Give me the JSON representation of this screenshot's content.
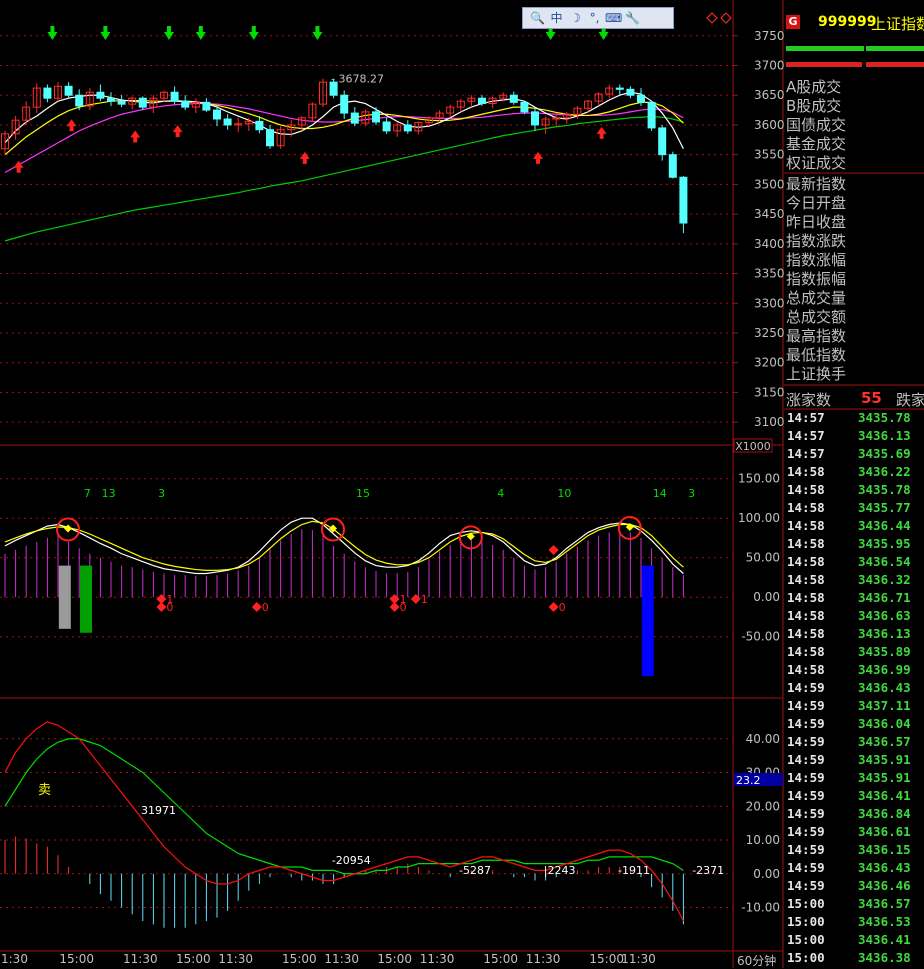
{
  "app": {
    "index_code": "999999",
    "index_name": "上证指数",
    "logo": "G",
    "period": "60分钟"
  },
  "toolbar": {
    "icons": [
      "magnify-icon",
      "chinese-input-icon",
      "moon-icon",
      "dots-icon",
      "keyboard-icon",
      "wrench-icon"
    ],
    "glyphs": [
      "🔍",
      "中",
      "☽",
      "°,",
      "⌨",
      "🔧"
    ]
  },
  "right_panel": {
    "labels": [
      "A股成交",
      "B股成交",
      "国债成交",
      "基金成交",
      "权证成交",
      "最新指数",
      "今日开盘",
      "昨日收盘",
      "指数涨跌",
      "指数涨幅",
      "指数振幅",
      "总成交量",
      "总成交额",
      "最高指数",
      "最低指数",
      "上证换手"
    ],
    "rise_label": "涨家数",
    "rise_count": "55",
    "fall_label": "跌家",
    "ticks": [
      [
        "14:57",
        "3435.78"
      ],
      [
        "14:57",
        "3436.13"
      ],
      [
        "14:57",
        "3435.69"
      ],
      [
        "14:58",
        "3436.22"
      ],
      [
        "14:58",
        "3435.78"
      ],
      [
        "14:58",
        "3435.77"
      ],
      [
        "14:58",
        "3436.44"
      ],
      [
        "14:58",
        "3435.95"
      ],
      [
        "14:58",
        "3436.54"
      ],
      [
        "14:58",
        "3436.32"
      ],
      [
        "14:58",
        "3436.71"
      ],
      [
        "14:58",
        "3436.63"
      ],
      [
        "14:58",
        "3436.13"
      ],
      [
        "14:58",
        "3435.89"
      ],
      [
        "14:58",
        "3436.99"
      ],
      [
        "14:59",
        "3436.43"
      ],
      [
        "14:59",
        "3437.11"
      ],
      [
        "14:59",
        "3436.04"
      ],
      [
        "14:59",
        "3436.57"
      ],
      [
        "14:59",
        "3435.91"
      ],
      [
        "14:59",
        "3435.91"
      ],
      [
        "14:59",
        "3436.41"
      ],
      [
        "14:59",
        "3436.84"
      ],
      [
        "14:59",
        "3436.61"
      ],
      [
        "14:59",
        "3436.15"
      ],
      [
        "14:59",
        "3436.43"
      ],
      [
        "14:59",
        "3436.46"
      ],
      [
        "15:00",
        "3436.57"
      ],
      [
        "15:00",
        "3436.53"
      ],
      [
        "15:00",
        "3436.41"
      ],
      [
        "15:00",
        "3436.38"
      ]
    ]
  },
  "colors": {
    "up": "#ff2a2a",
    "down": "#54ffff",
    "ma5": "#ffffff",
    "ma10": "#ffff00",
    "ma20": "#ff33ff",
    "ma60": "#00cc00",
    "grid": "#a01010"
  },
  "chart_data": [
    {
      "type": "candlestick",
      "yticks": [
        3100,
        3150,
        3200,
        3250,
        3300,
        3350,
        3400,
        3450,
        3500,
        3550,
        3600,
        3650,
        3700,
        3750
      ],
      "ylim": [
        3070,
        3790
      ],
      "annotation": "3678.27",
      "ohlc": [
        [
          3560,
          3590,
          3550,
          3585
        ],
        [
          3585,
          3615,
          3575,
          3608
        ],
        [
          3608,
          3640,
          3600,
          3630
        ],
        [
          3630,
          3670,
          3620,
          3662
        ],
        [
          3662,
          3668,
          3638,
          3645
        ],
        [
          3645,
          3672,
          3640,
          3665
        ],
        [
          3665,
          3672,
          3645,
          3650
        ],
        [
          3650,
          3660,
          3625,
          3632
        ],
        [
          3632,
          3662,
          3625,
          3655
        ],
        [
          3655,
          3668,
          3640,
          3645
        ],
        [
          3645,
          3655,
          3632,
          3640
        ],
        [
          3640,
          3650,
          3630,
          3635
        ],
        [
          3635,
          3648,
          3626,
          3645
        ],
        [
          3645,
          3648,
          3625,
          3630
        ],
        [
          3630,
          3650,
          3620,
          3645
        ],
        [
          3645,
          3658,
          3638,
          3655
        ],
        [
          3655,
          3665,
          3635,
          3640
        ],
        [
          3640,
          3650,
          3625,
          3630
        ],
        [
          3630,
          3645,
          3620,
          3638
        ],
        [
          3638,
          3645,
          3622,
          3625
        ],
        [
          3625,
          3632,
          3598,
          3610
        ],
        [
          3610,
          3618,
          3592,
          3600
        ],
        [
          3600,
          3612,
          3588,
          3602
        ],
        [
          3602,
          3612,
          3590,
          3606
        ],
        [
          3606,
          3615,
          3586,
          3592
        ],
        [
          3592,
          3600,
          3560,
          3565
        ],
        [
          3565,
          3598,
          3560,
          3592
        ],
        [
          3592,
          3608,
          3580,
          3600
        ],
        [
          3600,
          3615,
          3590,
          3612
        ],
        [
          3612,
          3638,
          3605,
          3635
        ],
        [
          3635,
          3678,
          3630,
          3672
        ],
        [
          3672,
          3678,
          3645,
          3650
        ],
        [
          3650,
          3658,
          3610,
          3620
        ],
        [
          3620,
          3630,
          3598,
          3603
        ],
        [
          3603,
          3626,
          3598,
          3622
        ],
        [
          3622,
          3630,
          3600,
          3605
        ],
        [
          3605,
          3612,
          3585,
          3590
        ],
        [
          3590,
          3605,
          3580,
          3600
        ],
        [
          3600,
          3608,
          3585,
          3590
        ],
        [
          3590,
          3606,
          3584,
          3604
        ],
        [
          3604,
          3615,
          3598,
          3612
        ],
        [
          3612,
          3625,
          3605,
          3620
        ],
        [
          3620,
          3634,
          3612,
          3630
        ],
        [
          3630,
          3644,
          3622,
          3640
        ],
        [
          3640,
          3650,
          3630,
          3645
        ],
        [
          3645,
          3650,
          3632,
          3636
        ],
        [
          3636,
          3648,
          3628,
          3645
        ],
        [
          3645,
          3655,
          3640,
          3650
        ],
        [
          3650,
          3656,
          3634,
          3638
        ],
        [
          3638,
          3640,
          3618,
          3622
        ],
        [
          3622,
          3630,
          3590,
          3600
        ],
        [
          3600,
          3614,
          3585,
          3610
        ],
        [
          3610,
          3620,
          3598,
          3612
        ],
        [
          3612,
          3622,
          3602,
          3618
        ],
        [
          3618,
          3632,
          3610,
          3628
        ],
        [
          3628,
          3642,
          3620,
          3640
        ],
        [
          3640,
          3655,
          3632,
          3652
        ],
        [
          3652,
          3668,
          3645,
          3662
        ],
        [
          3662,
          3668,
          3650,
          3660
        ],
        [
          3660,
          3665,
          3645,
          3650
        ],
        [
          3650,
          3662,
          3632,
          3638
        ],
        [
          3638,
          3640,
          3590,
          3595
        ],
        [
          3595,
          3600,
          3540,
          3550
        ],
        [
          3550,
          3555,
          3510,
          3512
        ],
        [
          3512,
          3514,
          3418,
          3435
        ]
      ],
      "green_arrows": [
        4,
        9,
        15,
        18,
        23,
        29,
        51,
        56
      ],
      "red_arrows": [
        1,
        6,
        12,
        16,
        28,
        50,
        56
      ],
      "ma5": [
        3570,
        3590,
        3605,
        3615,
        3628,
        3640,
        3645,
        3648,
        3650,
        3650,
        3646,
        3642,
        3640,
        3638,
        3637,
        3640,
        3641,
        3640,
        3639,
        3636,
        3630,
        3622,
        3615,
        3608,
        3600,
        3590,
        3585,
        3584,
        3590,
        3600,
        3614,
        3630,
        3638,
        3640,
        3636,
        3626,
        3616,
        3606,
        3598,
        3596,
        3598,
        3604,
        3612,
        3622,
        3630,
        3636,
        3640,
        3642,
        3644,
        3640,
        3630,
        3620,
        3612,
        3610,
        3615,
        3622,
        3632,
        3642,
        3650,
        3655,
        3652,
        3640,
        3620,
        3595,
        3560
      ],
      "ma10": [
        3550,
        3565,
        3580,
        3592,
        3604,
        3615,
        3624,
        3630,
        3634,
        3637,
        3640,
        3641,
        3641,
        3641,
        3640,
        3640,
        3640,
        3639,
        3638,
        3636,
        3633,
        3629,
        3624,
        3619,
        3613,
        3606,
        3600,
        3596,
        3594,
        3594,
        3596,
        3600,
        3606,
        3612,
        3616,
        3618,
        3618,
        3616,
        3613,
        3610,
        3608,
        3607,
        3608,
        3610,
        3614,
        3618,
        3622,
        3626,
        3630,
        3630,
        3628,
        3625,
        3621,
        3618,
        3616,
        3616,
        3618,
        3622,
        3628,
        3634,
        3638,
        3638,
        3632,
        3620,
        3603
      ],
      "ma20": [
        3520,
        3530,
        3540,
        3550,
        3560,
        3570,
        3580,
        3590,
        3598,
        3605,
        3612,
        3618,
        3622,
        3626,
        3629,
        3632,
        3634,
        3635,
        3636,
        3636,
        3635,
        3633,
        3630,
        3627,
        3623,
        3619,
        3615,
        3611,
        3608,
        3606,
        3605,
        3605,
        3606,
        3607,
        3609,
        3611,
        3613,
        3614,
        3614,
        3613,
        3612,
        3611,
        3611,
        3611,
        3612,
        3613,
        3615,
        3617,
        3619,
        3620,
        3620,
        3619,
        3618,
        3617,
        3616,
        3616,
        3616,
        3617,
        3619,
        3622,
        3625,
        3627,
        3626,
        3621,
        3612
      ],
      "ma60": [
        3405,
        3410,
        3415,
        3420,
        3424,
        3428,
        3432,
        3436,
        3440,
        3444,
        3448,
        3452,
        3456,
        3459,
        3462,
        3465,
        3468,
        3471,
        3474,
        3477,
        3480,
        3483,
        3486,
        3490,
        3493,
        3497,
        3500,
        3503,
        3506,
        3510,
        3514,
        3518,
        3522,
        3526,
        3530,
        3534,
        3538,
        3542,
        3546,
        3550,
        3554,
        3558,
        3562,
        3566,
        3570,
        3574,
        3578,
        3582,
        3585,
        3588,
        3591,
        3594,
        3597,
        3599,
        3602,
        3604,
        3606,
        3608,
        3610,
        3612,
        3613,
        3614,
        3613,
        3610,
        3605
      ]
    },
    {
      "type": "oscillator",
      "unit_label": "X1000",
      "yticks": [
        150,
        100,
        50,
        0,
        -50
      ],
      "ylim": [
        -120,
        180
      ],
      "labels": [
        [
          4,
          "7"
        ],
        [
          6,
          "13"
        ],
        [
          11,
          "3"
        ],
        [
          30,
          "15"
        ],
        [
          43,
          "4"
        ],
        [
          49,
          "10"
        ],
        [
          58,
          "14"
        ],
        [
          61,
          "3"
        ]
      ],
      "diamonds_label": [
        [
          14,
          "1"
        ],
        [
          14,
          "0"
        ],
        [
          23,
          "0"
        ],
        [
          36,
          "1"
        ],
        [
          36,
          "0"
        ],
        [
          38,
          "1"
        ],
        [
          51,
          "0"
        ]
      ],
      "circles": [
        5,
        30,
        43,
        58
      ],
      "line1": [
        65,
        72,
        78,
        84,
        90,
        92,
        88,
        82,
        75,
        68,
        62,
        55,
        50,
        45,
        40,
        36,
        34,
        32,
        30,
        30,
        32,
        34,
        38,
        46,
        58,
        72,
        85,
        95,
        100,
        100,
        92,
        80,
        68,
        56,
        46,
        40,
        38,
        38,
        40,
        46,
        56,
        68,
        78,
        82,
        84,
        82,
        78,
        70,
        58,
        46,
        40,
        42,
        50,
        62,
        72,
        82,
        88,
        92,
        94,
        92,
        84,
        72,
        58,
        42,
        30
      ],
      "line2": [
        70,
        75,
        80,
        84,
        87,
        89,
        88,
        85,
        80,
        74,
        68,
        62,
        56,
        50,
        46,
        42,
        39,
        37,
        35,
        34,
        34,
        35,
        37,
        42,
        50,
        62,
        74,
        84,
        92,
        96,
        94,
        86,
        75,
        64,
        54,
        47,
        43,
        41,
        41,
        44,
        50,
        60,
        70,
        77,
        81,
        82,
        80,
        74,
        64,
        54,
        46,
        44,
        48,
        58,
        68,
        78,
        85,
        89,
        92,
        92,
        88,
        78,
        64,
        50,
        38
      ],
      "hist": [
        55,
        60,
        65,
        70,
        75,
        80,
        70,
        62,
        55,
        50,
        45,
        40,
        38,
        35,
        32,
        30,
        28,
        28,
        27,
        27,
        28,
        30,
        34,
        40,
        50,
        62,
        72,
        80,
        86,
        85,
        78,
        65,
        55,
        45,
        38,
        33,
        30,
        30,
        32,
        38,
        48,
        58,
        66,
        70,
        72,
        70,
        66,
        60,
        50,
        40,
        35,
        38,
        45,
        55,
        64,
        72,
        78,
        82,
        84,
        82,
        75,
        62,
        50,
        38,
        28
      ],
      "bars": [
        [
          3,
          -40,
          "#9a9a9a"
        ],
        [
          5,
          -45,
          "#00a000"
        ],
        [
          58,
          -100,
          "#0000ff"
        ]
      ]
    },
    {
      "type": "macd",
      "yticks": [
        40,
        30,
        20,
        10,
        0,
        -10
      ],
      "ylim": [
        -22,
        50
      ],
      "current": "23.2",
      "sell_label": "卖",
      "labels": [
        [
          10,
          "31971"
        ],
        [
          28,
          "-20954"
        ],
        [
          40,
          "-5287"
        ],
        [
          48,
          "|2243"
        ],
        [
          55,
          "-1911"
        ],
        [
          62,
          "-2371"
        ]
      ],
      "dif": [
        30,
        36,
        40,
        43,
        45,
        44,
        42,
        40,
        36,
        32,
        28,
        24,
        20,
        16,
        12,
        8,
        5,
        2,
        0,
        -2,
        -3,
        -3,
        -2,
        0,
        1,
        2,
        2,
        1,
        0,
        -1,
        -2,
        -2,
        -1,
        0,
        1,
        2,
        3,
        4,
        5,
        5,
        4,
        3,
        2,
        3,
        4,
        5,
        5,
        4,
        3,
        2,
        1,
        1,
        2,
        3,
        4,
        5,
        6,
        7,
        7,
        6,
        4,
        1,
        -3,
        -8,
        -14
      ],
      "dea": [
        20,
        25,
        30,
        34,
        37,
        39,
        40,
        40,
        39,
        38,
        36,
        34,
        32,
        30,
        27,
        24,
        21,
        18,
        15,
        12,
        10,
        8,
        6,
        5,
        4,
        3,
        2,
        2,
        2,
        1,
        1,
        1,
        0,
        0,
        0,
        1,
        1,
        2,
        2,
        3,
        3,
        3,
        3,
        3,
        3,
        4,
        4,
        4,
        4,
        3,
        3,
        3,
        3,
        3,
        3,
        4,
        4,
        5,
        5,
        5,
        5,
        5,
        4,
        3,
        1
      ],
      "macd": [
        20,
        22,
        21,
        18,
        16,
        11,
        4,
        0,
        -6,
        -12,
        -16,
        -20,
        -24,
        -28,
        -30,
        -32,
        -32,
        -32,
        -30,
        -28,
        -26,
        -22,
        -16,
        -10,
        -6,
        -2,
        0,
        -2,
        -4,
        -4,
        -6,
        -6,
        -2,
        0,
        2,
        2,
        4,
        4,
        6,
        4,
        2,
        0,
        -2,
        0,
        2,
        2,
        2,
        0,
        -2,
        -2,
        -4,
        -4,
        -2,
        0,
        2,
        2,
        4,
        4,
        4,
        2,
        -2,
        -8,
        -14,
        -22,
        -30
      ]
    }
  ],
  "time_axis": [
    [
      "1:30",
      0
    ],
    [
      "15:00",
      4
    ],
    [
      "11:30",
      10
    ],
    [
      "15:00",
      15
    ],
    [
      "11:30",
      19
    ],
    [
      "15:00",
      25
    ],
    [
      "11:30",
      29
    ],
    [
      "15:00",
      34
    ],
    [
      "11:30",
      38
    ],
    [
      "15:00",
      44
    ],
    [
      "11:30",
      48
    ],
    [
      "15:00",
      54
    ],
    [
      "11:30",
      57
    ]
  ]
}
